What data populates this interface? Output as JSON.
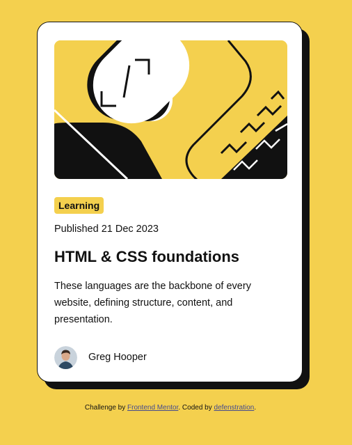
{
  "card": {
    "image_alt": "Illustration",
    "tag": "Learning",
    "published": "Published 21 Dec 2023",
    "title": "HTML & CSS foundations",
    "description": "These languages are the backbone of every website, defining structure, content, and presentation.",
    "author": {
      "name": "Greg Hooper",
      "avatar_icon": "avatar-photo"
    }
  },
  "attribution": {
    "prefix": "Challenge by ",
    "link1": "Frontend Mentor",
    "middle": ". Coded by ",
    "link2": "defenstration",
    "suffix": "."
  },
  "colors": {
    "background": "#f4d04e",
    "card": "#ffffff",
    "text": "#111111",
    "link": "#444a8f"
  }
}
